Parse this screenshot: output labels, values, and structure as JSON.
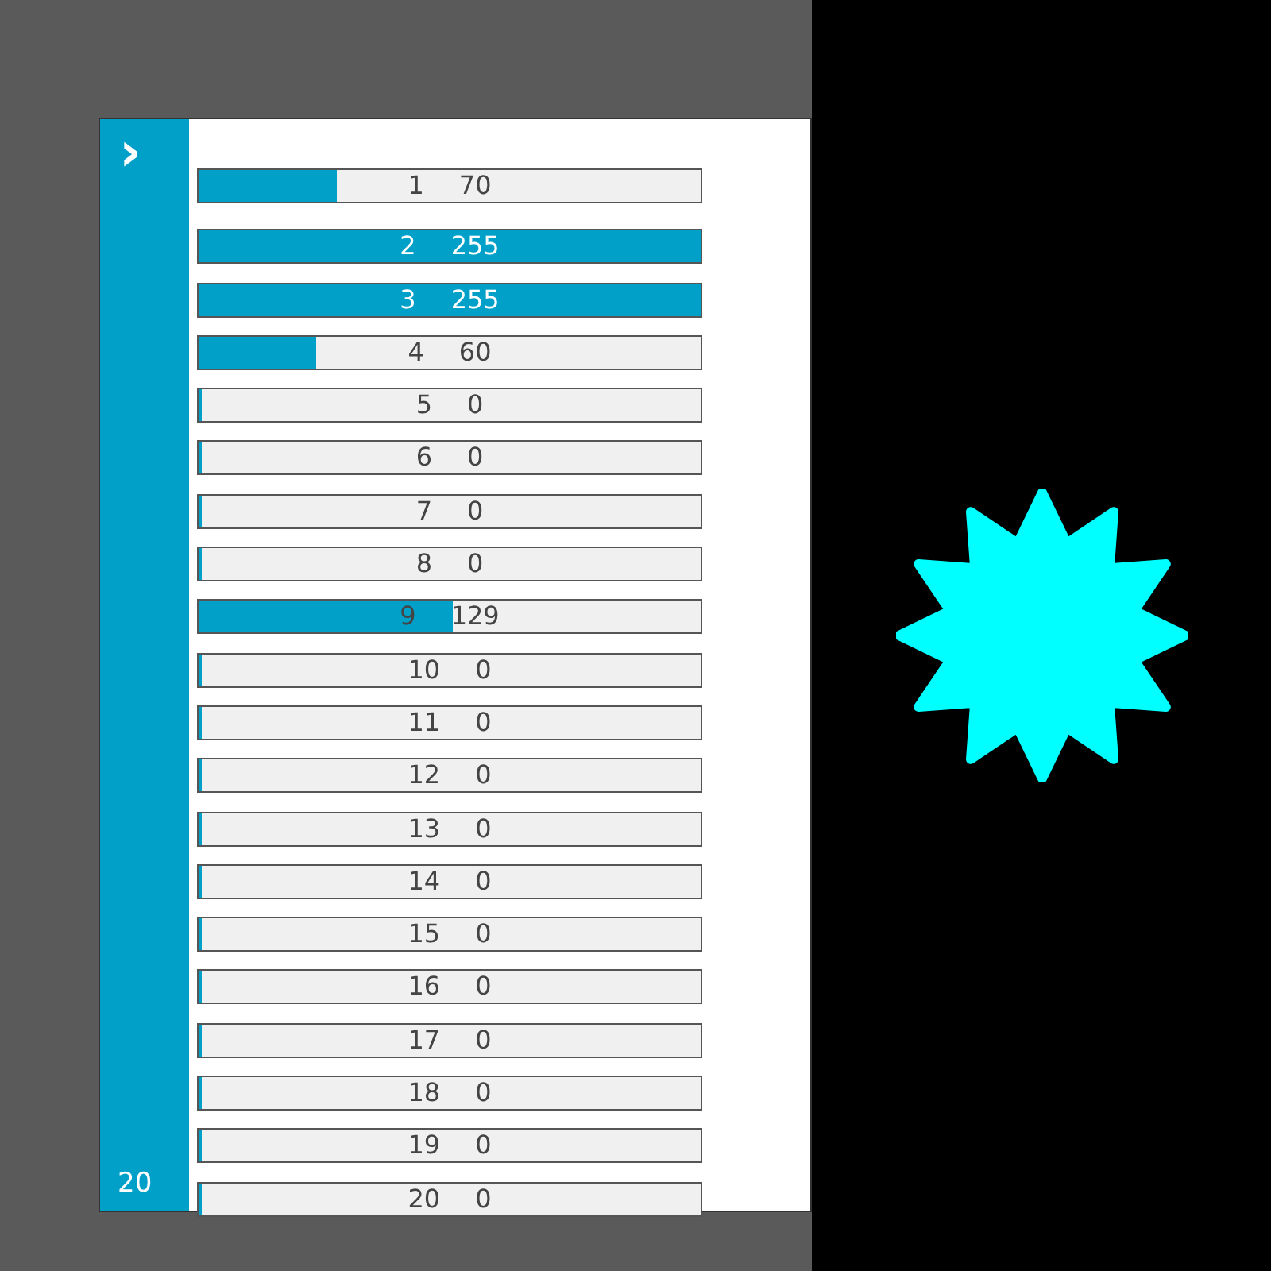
{
  "sidebar": {
    "expand_glyph": "›",
    "footer_text": "20"
  },
  "channels": [
    {
      "index": "1",
      "value": "70",
      "level": 0.2745
    },
    {
      "index": "2",
      "value": "255",
      "level": 1
    },
    {
      "index": "3",
      "value": "255",
      "level": 1
    },
    {
      "index": "4",
      "value": "60",
      "level": 0.2353
    },
    {
      "index": "5",
      "value": "0",
      "level": 0
    },
    {
      "index": "6",
      "value": "0",
      "level": 0
    },
    {
      "index": "7",
      "value": "0",
      "level": 0
    },
    {
      "index": "8",
      "value": "0",
      "level": 0
    },
    {
      "index": "9",
      "value": "129",
      "level": 0.5059
    },
    {
      "index": "10",
      "value": "0",
      "level": 0
    },
    {
      "index": "11",
      "value": "0",
      "level": 0
    },
    {
      "index": "12",
      "value": "0",
      "level": 0
    },
    {
      "index": "13",
      "value": "0",
      "level": 0
    },
    {
      "index": "14",
      "value": "0",
      "level": 0
    },
    {
      "index": "15",
      "value": "0",
      "level": 0
    },
    {
      "index": "16",
      "value": "0",
      "level": 0
    },
    {
      "index": "17",
      "value": "0",
      "level": 0
    },
    {
      "index": "18",
      "value": "0",
      "level": 0
    },
    {
      "index": "19",
      "value": "0",
      "level": 0
    },
    {
      "index": "20",
      "value": "0",
      "level": 0
    }
  ]
}
